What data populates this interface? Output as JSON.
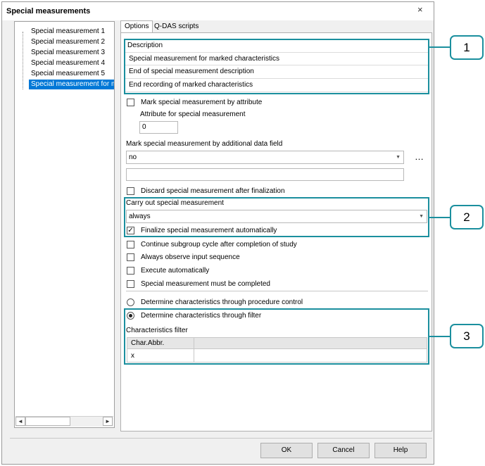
{
  "dialog": {
    "title": "Special measurements",
    "close_glyph": "×"
  },
  "tree": {
    "items": [
      "Special measurement 1",
      "Special measurement 2",
      "Special measurement 3",
      "Special measurement 4",
      "Special measurement 5",
      "Special measurement for marked characteristics"
    ],
    "selected_index": 5
  },
  "tabs": {
    "options": "Options",
    "qdas": "Q-DAS scripts"
  },
  "description": {
    "header": "Description",
    "rows": [
      "Special measurement for marked characteristics",
      "End of special measurement description",
      "End recording of marked characteristics"
    ]
  },
  "attribute": {
    "mark_label": "Mark special measurement by attribute",
    "attr_label": "Attribute for special measurement",
    "attr_value": "0"
  },
  "additional": {
    "label": "Mark special measurement by additional data field",
    "combo_value": "no",
    "more_glyph": "…",
    "extra_value": ""
  },
  "discard": {
    "label": "Discard special measurement after finalization"
  },
  "carry_out": {
    "label": "Carry out special measurement",
    "combo_value": "always",
    "finalize_label": "Finalize special measurement automatically",
    "finalize_checked": true
  },
  "checkboxes": [
    "Continue subgroup cycle after completion of study",
    "Always observe input sequence",
    "Execute automatically",
    "Special measurement must be completed"
  ],
  "determine": {
    "procedure_label": "Determine characteristics through procedure control",
    "filter_label": "Determine characteristics through filter",
    "selected": "filter"
  },
  "filter": {
    "label": "Characteristics filter",
    "col_header": "Char.Abbr.",
    "row_value": "x"
  },
  "callouts": [
    "1",
    "2",
    "3"
  ],
  "buttons": {
    "ok": "OK",
    "cancel": "Cancel",
    "help": "Help"
  },
  "colors": {
    "accent": "#1b8f9e",
    "selection": "#0078d7"
  },
  "icons": {
    "check": "✓",
    "scroll_left": "◄",
    "scroll_right": "►",
    "dropdown": "▼"
  }
}
